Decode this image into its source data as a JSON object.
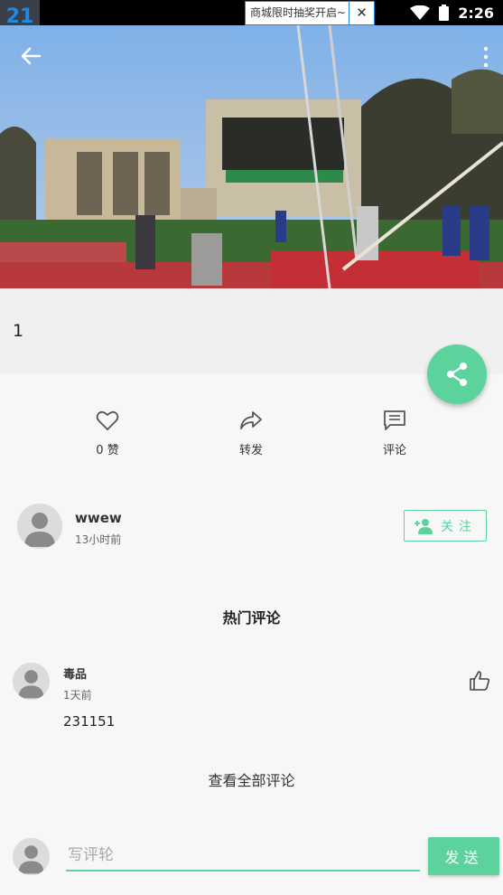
{
  "status_bar": {
    "app_icon_text": "21",
    "banner_text": "商城限时抽奖开启~",
    "banner_close_icon": "close-icon",
    "time": "2:26"
  },
  "video": {
    "back_icon": "arrow-left-icon",
    "more_icon": "more-vertical-icon"
  },
  "post": {
    "title": "1",
    "share_icon": "share-icon"
  },
  "actions": {
    "like": {
      "icon": "heart-icon",
      "label": "0 赞"
    },
    "repost": {
      "icon": "forward-icon",
      "label": "转发"
    },
    "comment": {
      "icon": "comment-icon",
      "label": "评论"
    }
  },
  "author": {
    "name": "wwew",
    "time": "13小时前",
    "follow_label": "关注",
    "follow_icon": "add-user-icon"
  },
  "hot_comments": {
    "title": "热门评论",
    "items": [
      {
        "user": "毒品",
        "time": "1天前",
        "text": "231151",
        "like_icon": "thumbs-up-icon"
      }
    ],
    "view_all": "查看全部评论"
  },
  "compose": {
    "placeholder": "写评轮",
    "send_label": "发送"
  },
  "colors": {
    "accent": "#5cd29c",
    "status_bar": "#000000"
  }
}
